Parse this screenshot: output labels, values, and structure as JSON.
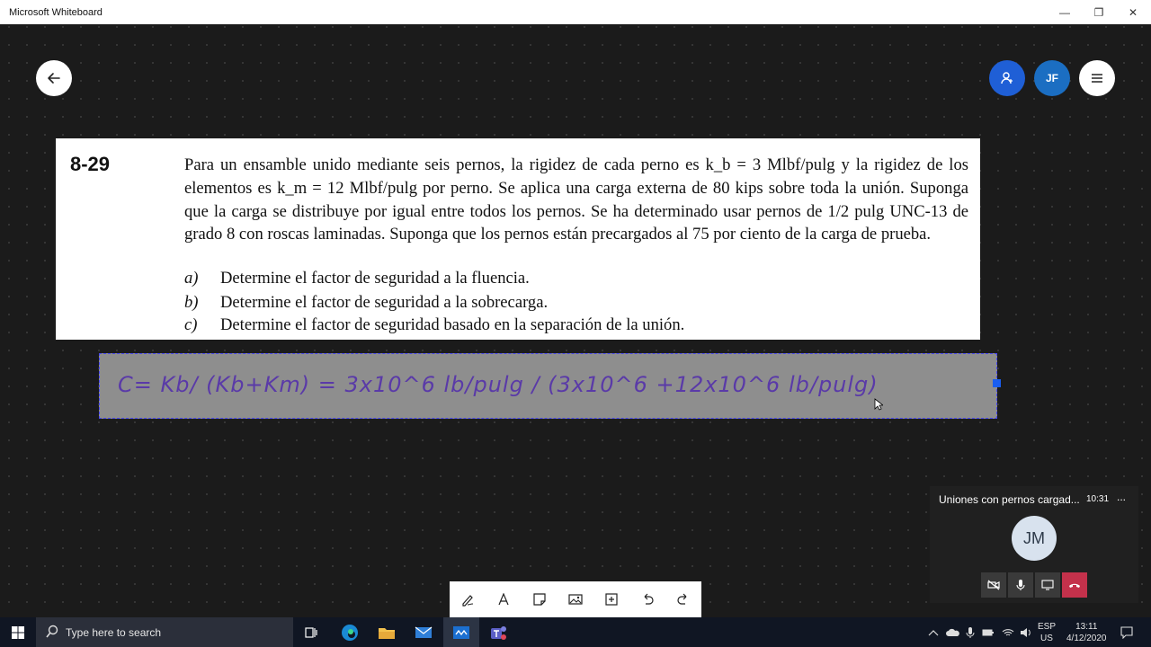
{
  "window": {
    "title": "Microsoft Whiteboard",
    "minimize": "—",
    "restore": "❐",
    "close": "✕"
  },
  "header": {
    "avatar_initials": "JF"
  },
  "problem": {
    "number": "8-29",
    "text": "Para un ensamble unido mediante seis pernos, la rigidez de cada perno es k_b = 3 Mlbf/pulg y la rigidez de los elementos es k_m = 12 Mlbf/pulg por perno. Se aplica una carga externa de 80 kips sobre toda la unión. Suponga que la carga se distribuye por igual entre todos los pernos. Se ha determinado usar pernos de 1/2 pulg UNC-13 de grado 8 con roscas laminadas. Suponga que los pernos están precargados al 75 por ciento de la carga de prueba.",
    "items": [
      {
        "label": "a)",
        "text": "Determine el factor de seguridad a la fluencia."
      },
      {
        "label": "b)",
        "text": "Determine el factor de seguridad a la sobrecarga."
      },
      {
        "label": "c)",
        "text": "Determine el factor de seguridad basado en la separación de la unión."
      }
    ]
  },
  "ink_note": {
    "text": "C= Kb/ (Kb+Km) = 3x10^6 lb/pulg / (3x10^6 +12x10^6 lb/pulg)"
  },
  "call": {
    "title": "Uniones con pernos cargad...",
    "time": "10:31",
    "more": "...",
    "avatar_initials": "JM"
  },
  "taskbar": {
    "search_placeholder": "Type here to search",
    "lang_top": "ESP",
    "lang_bottom": "US",
    "clock_time": "13:11",
    "clock_date": "4/12/2020"
  },
  "colors": {
    "accent_blue": "#1f5fd6",
    "ink_purple": "#5a3aa8",
    "hangup_red": "#c4314b"
  }
}
